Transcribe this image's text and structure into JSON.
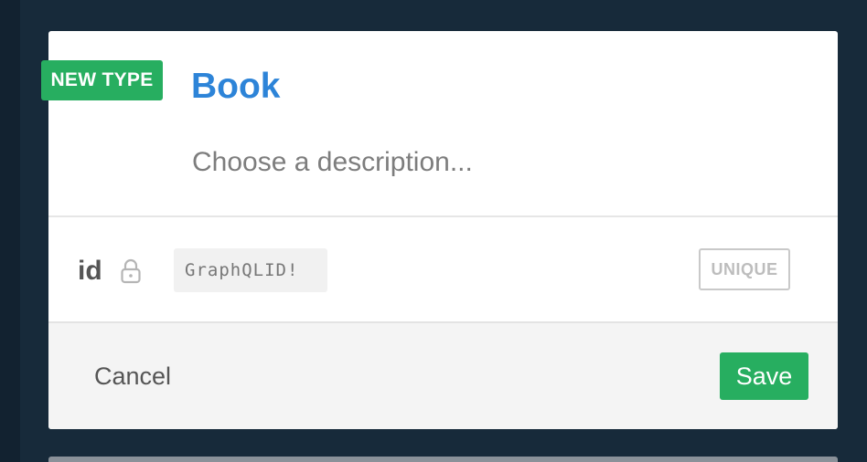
{
  "badge": {
    "label": "NEW TYPE",
    "color": "#27ae60"
  },
  "type": {
    "name": "Book",
    "description_placeholder": "Choose a description...",
    "name_color": "#2d84d8"
  },
  "fields": [
    {
      "name": "id",
      "locked_icon": "lock-icon",
      "type": "GraphQLID!",
      "constraint": "UNIQUE"
    }
  ],
  "footer": {
    "cancel_label": "Cancel",
    "save_label": "Save",
    "save_color": "#27ae60"
  }
}
